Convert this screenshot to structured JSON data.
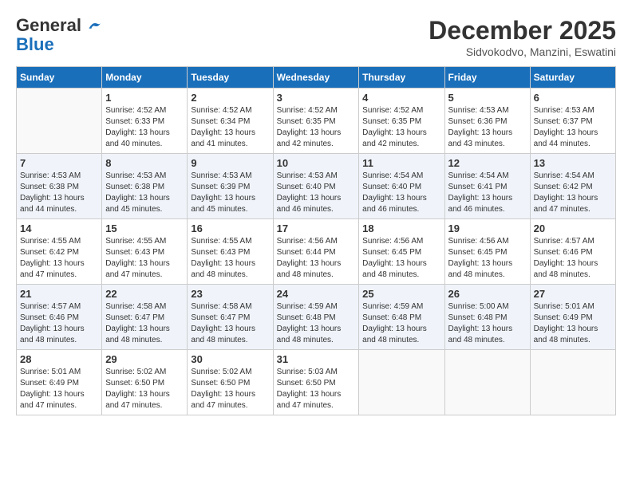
{
  "header": {
    "logo_general": "General",
    "logo_blue": "Blue",
    "month_year": "December 2025",
    "location": "Sidvokodvo, Manzini, Eswatini"
  },
  "days_of_week": [
    "Sunday",
    "Monday",
    "Tuesday",
    "Wednesday",
    "Thursday",
    "Friday",
    "Saturday"
  ],
  "weeks": [
    [
      {
        "day": "",
        "sunrise": "",
        "sunset": "",
        "daylight": ""
      },
      {
        "day": "1",
        "sunrise": "Sunrise: 4:52 AM",
        "sunset": "Sunset: 6:33 PM",
        "daylight": "Daylight: 13 hours and 40 minutes."
      },
      {
        "day": "2",
        "sunrise": "Sunrise: 4:52 AM",
        "sunset": "Sunset: 6:34 PM",
        "daylight": "Daylight: 13 hours and 41 minutes."
      },
      {
        "day": "3",
        "sunrise": "Sunrise: 4:52 AM",
        "sunset": "Sunset: 6:35 PM",
        "daylight": "Daylight: 13 hours and 42 minutes."
      },
      {
        "day": "4",
        "sunrise": "Sunrise: 4:52 AM",
        "sunset": "Sunset: 6:35 PM",
        "daylight": "Daylight: 13 hours and 42 minutes."
      },
      {
        "day": "5",
        "sunrise": "Sunrise: 4:53 AM",
        "sunset": "Sunset: 6:36 PM",
        "daylight": "Daylight: 13 hours and 43 minutes."
      },
      {
        "day": "6",
        "sunrise": "Sunrise: 4:53 AM",
        "sunset": "Sunset: 6:37 PM",
        "daylight": "Daylight: 13 hours and 44 minutes."
      }
    ],
    [
      {
        "day": "7",
        "sunrise": "Sunrise: 4:53 AM",
        "sunset": "Sunset: 6:38 PM",
        "daylight": "Daylight: 13 hours and 44 minutes."
      },
      {
        "day": "8",
        "sunrise": "Sunrise: 4:53 AM",
        "sunset": "Sunset: 6:38 PM",
        "daylight": "Daylight: 13 hours and 45 minutes."
      },
      {
        "day": "9",
        "sunrise": "Sunrise: 4:53 AM",
        "sunset": "Sunset: 6:39 PM",
        "daylight": "Daylight: 13 hours and 45 minutes."
      },
      {
        "day": "10",
        "sunrise": "Sunrise: 4:53 AM",
        "sunset": "Sunset: 6:40 PM",
        "daylight": "Daylight: 13 hours and 46 minutes."
      },
      {
        "day": "11",
        "sunrise": "Sunrise: 4:54 AM",
        "sunset": "Sunset: 6:40 PM",
        "daylight": "Daylight: 13 hours and 46 minutes."
      },
      {
        "day": "12",
        "sunrise": "Sunrise: 4:54 AM",
        "sunset": "Sunset: 6:41 PM",
        "daylight": "Daylight: 13 hours and 46 minutes."
      },
      {
        "day": "13",
        "sunrise": "Sunrise: 4:54 AM",
        "sunset": "Sunset: 6:42 PM",
        "daylight": "Daylight: 13 hours and 47 minutes."
      }
    ],
    [
      {
        "day": "14",
        "sunrise": "Sunrise: 4:55 AM",
        "sunset": "Sunset: 6:42 PM",
        "daylight": "Daylight: 13 hours and 47 minutes."
      },
      {
        "day": "15",
        "sunrise": "Sunrise: 4:55 AM",
        "sunset": "Sunset: 6:43 PM",
        "daylight": "Daylight: 13 hours and 47 minutes."
      },
      {
        "day": "16",
        "sunrise": "Sunrise: 4:55 AM",
        "sunset": "Sunset: 6:43 PM",
        "daylight": "Daylight: 13 hours and 48 minutes."
      },
      {
        "day": "17",
        "sunrise": "Sunrise: 4:56 AM",
        "sunset": "Sunset: 6:44 PM",
        "daylight": "Daylight: 13 hours and 48 minutes."
      },
      {
        "day": "18",
        "sunrise": "Sunrise: 4:56 AM",
        "sunset": "Sunset: 6:45 PM",
        "daylight": "Daylight: 13 hours and 48 minutes."
      },
      {
        "day": "19",
        "sunrise": "Sunrise: 4:56 AM",
        "sunset": "Sunset: 6:45 PM",
        "daylight": "Daylight: 13 hours and 48 minutes."
      },
      {
        "day": "20",
        "sunrise": "Sunrise: 4:57 AM",
        "sunset": "Sunset: 6:46 PM",
        "daylight": "Daylight: 13 hours and 48 minutes."
      }
    ],
    [
      {
        "day": "21",
        "sunrise": "Sunrise: 4:57 AM",
        "sunset": "Sunset: 6:46 PM",
        "daylight": "Daylight: 13 hours and 48 minutes."
      },
      {
        "day": "22",
        "sunrise": "Sunrise: 4:58 AM",
        "sunset": "Sunset: 6:47 PM",
        "daylight": "Daylight: 13 hours and 48 minutes."
      },
      {
        "day": "23",
        "sunrise": "Sunrise: 4:58 AM",
        "sunset": "Sunset: 6:47 PM",
        "daylight": "Daylight: 13 hours and 48 minutes."
      },
      {
        "day": "24",
        "sunrise": "Sunrise: 4:59 AM",
        "sunset": "Sunset: 6:48 PM",
        "daylight": "Daylight: 13 hours and 48 minutes."
      },
      {
        "day": "25",
        "sunrise": "Sunrise: 4:59 AM",
        "sunset": "Sunset: 6:48 PM",
        "daylight": "Daylight: 13 hours and 48 minutes."
      },
      {
        "day": "26",
        "sunrise": "Sunrise: 5:00 AM",
        "sunset": "Sunset: 6:48 PM",
        "daylight": "Daylight: 13 hours and 48 minutes."
      },
      {
        "day": "27",
        "sunrise": "Sunrise: 5:01 AM",
        "sunset": "Sunset: 6:49 PM",
        "daylight": "Daylight: 13 hours and 48 minutes."
      }
    ],
    [
      {
        "day": "28",
        "sunrise": "Sunrise: 5:01 AM",
        "sunset": "Sunset: 6:49 PM",
        "daylight": "Daylight: 13 hours and 47 minutes."
      },
      {
        "day": "29",
        "sunrise": "Sunrise: 5:02 AM",
        "sunset": "Sunset: 6:50 PM",
        "daylight": "Daylight: 13 hours and 47 minutes."
      },
      {
        "day": "30",
        "sunrise": "Sunrise: 5:02 AM",
        "sunset": "Sunset: 6:50 PM",
        "daylight": "Daylight: 13 hours and 47 minutes."
      },
      {
        "day": "31",
        "sunrise": "Sunrise: 5:03 AM",
        "sunset": "Sunset: 6:50 PM",
        "daylight": "Daylight: 13 hours and 47 minutes."
      },
      {
        "day": "",
        "sunrise": "",
        "sunset": "",
        "daylight": ""
      },
      {
        "day": "",
        "sunrise": "",
        "sunset": "",
        "daylight": ""
      },
      {
        "day": "",
        "sunrise": "",
        "sunset": "",
        "daylight": ""
      }
    ]
  ]
}
